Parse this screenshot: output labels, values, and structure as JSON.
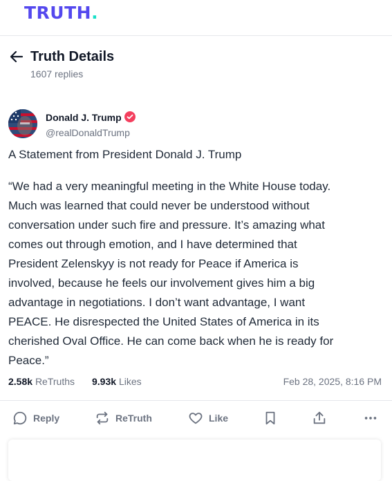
{
  "app": {
    "logo_text": "TRUTH",
    "logo_dot": ".",
    "brand_color": "#5448ee",
    "accent_color": "#17e0c8"
  },
  "header": {
    "back_icon": "arrow-left-icon",
    "title": "Truth Details",
    "replies": "1607 replies"
  },
  "post": {
    "author": {
      "name": "Donald J. Trump",
      "handle": "@realDonaldTrump",
      "verified": true,
      "verified_color": "#f43f5e"
    },
    "title": "A Statement from President Donald J. Trump",
    "body": "“We had a very meaningful meeting in the White House today.\nMuch was learned that could never be understood without\nconversation under such fire and pressure. It’s amazing what\ncomes out through emotion, and I have determined that\nPresident Zelenskyy is not ready for Peace if America is\ninvolved, because he feels our involvement gives him a big\nadvantage in negotiations. I don’t want advantage, I want\nPEACE. He disrespected the United States of America in its\ncherished Oval Office. He can come back when he is ready for\nPeace.”",
    "stats": {
      "retruths_count": "2.58k",
      "retruths_label": "ReTruths",
      "likes_count": "9.93k",
      "likes_label": "Likes"
    },
    "timestamp": "Feb 28, 2025, 8:16 PM"
  },
  "actions": {
    "reply": "Reply",
    "retruth": "ReTruth",
    "like": "Like",
    "icons": [
      "reply-icon",
      "retruth-icon",
      "heart-icon",
      "bookmark-icon",
      "share-icon",
      "more-icon"
    ]
  }
}
